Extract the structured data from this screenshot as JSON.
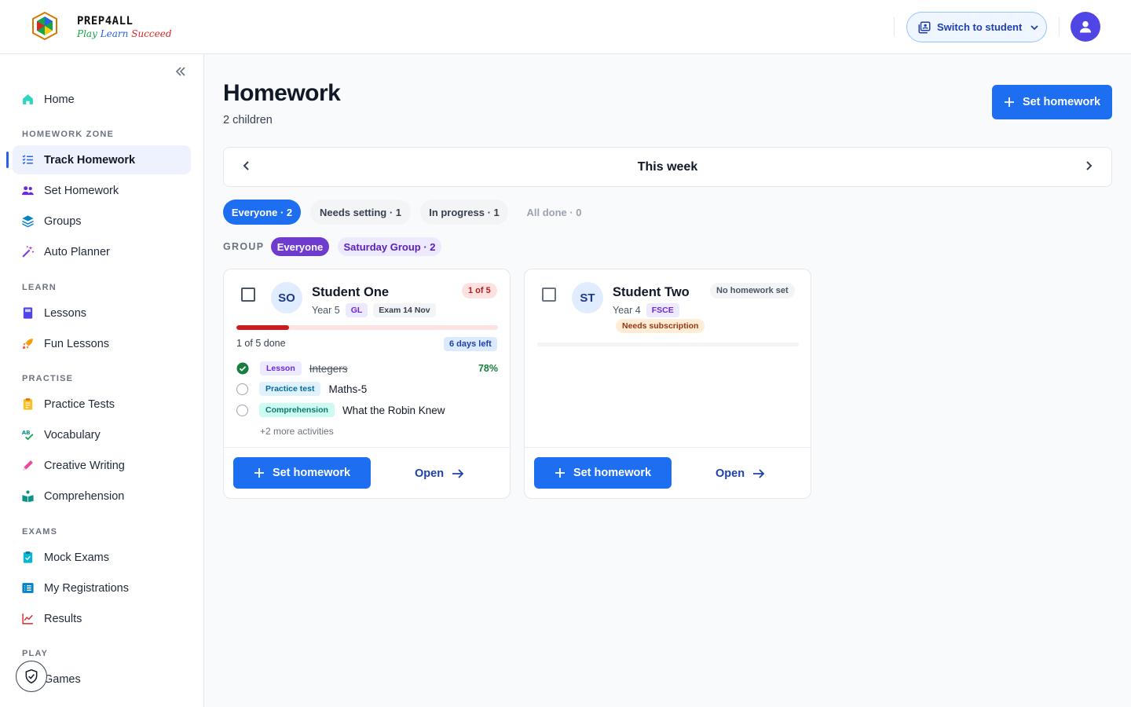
{
  "app": {
    "logo_title": "PREP4ALL",
    "logo_tag_1": "Play",
    "logo_tag_2": "Learn",
    "logo_tag_3": "Succeed"
  },
  "header": {
    "switch_label": "Switch to student",
    "avatar_icon": "user-icon"
  },
  "sidebar": {
    "home": "Home",
    "sections": {
      "homework_zone": "HOMEWORK ZONE",
      "learn": "LEARN",
      "practise": "PRACTISE",
      "exams": "EXAMS",
      "play": "PLAY"
    },
    "items": {
      "track_homework": "Track Homework",
      "set_homework": "Set Homework",
      "groups": "Groups",
      "auto_planner": "Auto Planner",
      "lessons": "Lessons",
      "fun_lessons": "Fun Lessons",
      "practice_tests": "Practice Tests",
      "vocabulary": "Vocabulary",
      "creative_writing": "Creative Writing",
      "comprehension": "Comprehension",
      "mock_exams": "Mock Exams",
      "my_registrations": "My Registrations",
      "results": "Results",
      "games": "Games"
    }
  },
  "main": {
    "title": "Homework",
    "subtitle": "2 children",
    "set_homework_label": "Set homework",
    "week_label": "This week",
    "filters": {
      "everyone": "Everyone · 2",
      "needs_setting": "Needs setting · 1",
      "in_progress": "In progress · 1",
      "all_done": "All done · 0"
    },
    "group_label": "GROUP",
    "groups": {
      "everyone": "Everyone",
      "saturday": "Saturday Group · 2"
    }
  },
  "students": [
    {
      "initials": "SO",
      "name": "Student One",
      "year": "Year 5",
      "tag": "GL",
      "exam": "Exam 14 Nov",
      "status_badge": "1 of 5",
      "progress_fraction": 0.2,
      "done_text": "1 of 5 done",
      "days_left": "6 days left",
      "activities": [
        {
          "type": "Lesson",
          "title": "Integers",
          "score": "78%",
          "done": true
        },
        {
          "type": "Practice test",
          "title": "Maths-5",
          "score": "",
          "done": false
        },
        {
          "type": "Comprehension",
          "title": "What the Robin Knew",
          "score": "",
          "done": false
        }
      ],
      "more": "+2 more activities",
      "set_label": "Set homework",
      "open_label": "Open"
    },
    {
      "initials": "ST",
      "name": "Student Two",
      "year": "Year 4",
      "tag": "FSCE",
      "status_badge": "No homework set",
      "subscription": "Needs subscription",
      "progress_fraction": 0,
      "set_label": "Set homework",
      "open_label": "Open"
    }
  ],
  "colors": {
    "primary": "#1d6ef0",
    "active_nav": "#eef2ff",
    "progress_red": "#c81e1e",
    "group_active": "#6d3ccf"
  }
}
